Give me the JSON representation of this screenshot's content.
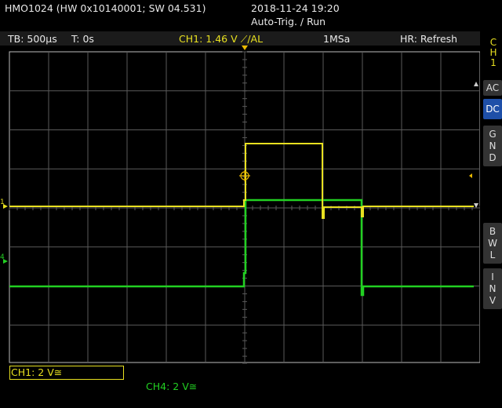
{
  "title": {
    "device": "HMO1024 (HW 0x10140001; SW 04.531)",
    "datetime": "2018-11-24 19:20",
    "mode": "Auto-Trig. / Run"
  },
  "status": {
    "timebase": "TB: 500µs",
    "trigger_time": "T: 0s",
    "trigger_info": "CH1: 1.46 V ⟋/AL",
    "sample_rate": "1MSa",
    "hr": "HR: Refresh"
  },
  "side": {
    "channel": [
      "C",
      "H",
      "1"
    ],
    "ac": "AC",
    "dc": "DC",
    "gnd": [
      "G",
      "N",
      "D"
    ],
    "bwl": [
      "B",
      "W",
      "L"
    ],
    "inv": [
      "I",
      "N",
      "V"
    ]
  },
  "footer": {
    "ch1": "CH1: 2 V≅",
    "ch4": "CH4: 2 V≅"
  },
  "markers": {
    "ch1": "1",
    "ch4": "4"
  },
  "colors": {
    "ch1": "#e8e020",
    "ch4": "#22d022",
    "grid": "#5a5a5a",
    "trigger": "#e8b800"
  }
}
